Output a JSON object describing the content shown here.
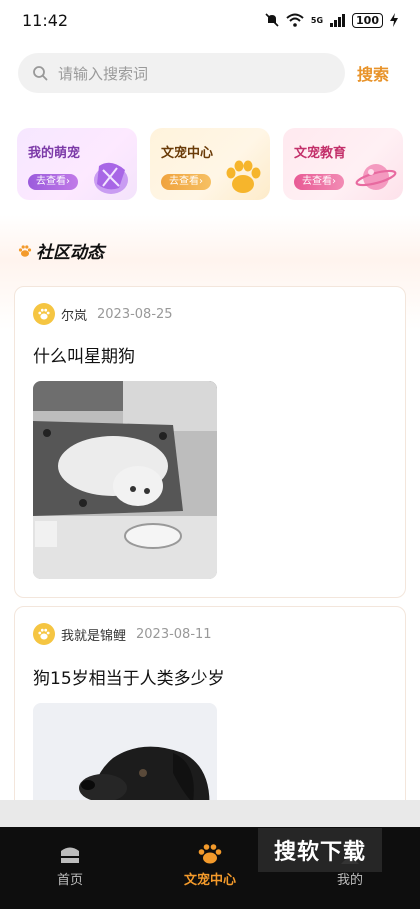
{
  "status_bar": {
    "time": "11:42",
    "network": "5G",
    "battery": "100"
  },
  "search": {
    "placeholder": "请输入搜索词",
    "button_label": "搜索"
  },
  "feature_cards": [
    {
      "title": "我的萌宠",
      "button": "去查看›",
      "icon": "pet-icon",
      "accent": "#9b5bdc"
    },
    {
      "title": "文宠中心",
      "button": "去查看›",
      "icon": "paw-icon",
      "accent": "#f0a33e"
    },
    {
      "title": "文宠教育",
      "button": "去查看›",
      "icon": "planet-icon",
      "accent": "#e85a95"
    }
  ],
  "section": {
    "title": "社区动态"
  },
  "posts": [
    {
      "author": "尔岚",
      "date": "2023-08-25",
      "title": "什么叫星期狗",
      "image": "dog-photo-poodle"
    },
    {
      "author": "我就是锦鲤",
      "date": "2023-08-11",
      "title": "狗15岁相当于人类多少岁",
      "image": "dog-photo-black-labrador"
    }
  ],
  "bottom_nav": {
    "items": [
      {
        "label": "首页",
        "icon": "home-icon",
        "active": false
      },
      {
        "label": "文宠中心",
        "icon": "paw-icon",
        "active": true
      },
      {
        "label": "我的",
        "icon": "profile-icon",
        "active": false
      }
    ]
  },
  "watermark": "搜软下载",
  "colors": {
    "accent": "#f39a2b",
    "search_button": "#e8932a",
    "nav_background": "#0e0e0e"
  }
}
